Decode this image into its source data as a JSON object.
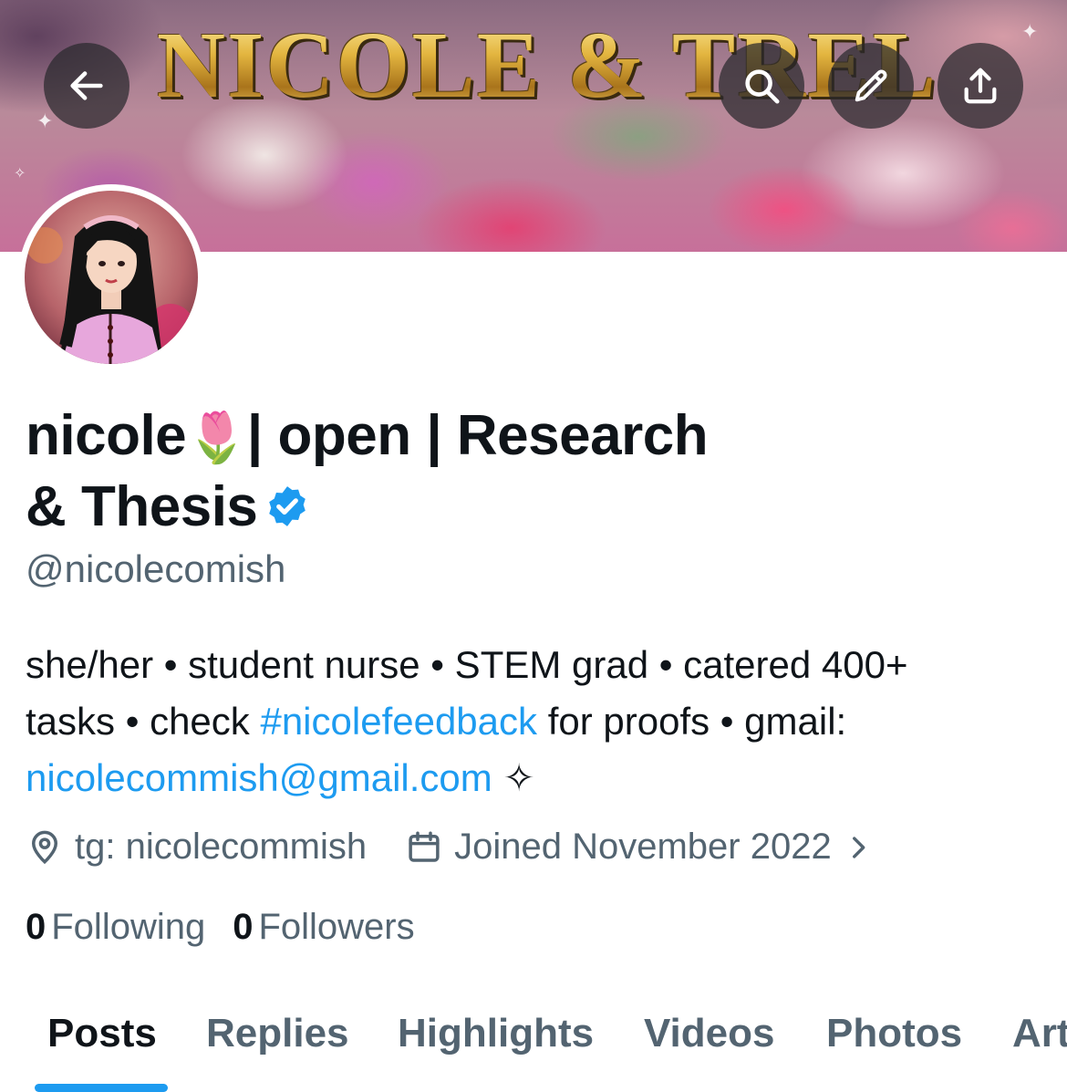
{
  "header": {
    "banner_title": "NICOLE & TREL",
    "back_label": "Back",
    "search_label": "Search",
    "edit_label": "Edit",
    "share_label": "Share",
    "icons": [
      "arrow-left-icon",
      "search-icon",
      "pencil-icon",
      "share-icon"
    ]
  },
  "profile": {
    "name_line1_part1": "nicole",
    "name_emoji": "🌷",
    "name_line1_part2": "| open | Research",
    "name_line2": "& Thesis",
    "handle": "@nicolecomish",
    "verified_color": "#1d9bf0"
  },
  "bio": {
    "line1": "she/her • student nurse • STEM grad • catered 400+",
    "line2_a": "tasks • check ",
    "hashtag": "#nicolefeedback",
    "line2_b": " for proofs • gmail:",
    "email": "nicolecommish@gmail.com",
    "sparkle": " ✧"
  },
  "meta": {
    "location": "tg: nicolecommish",
    "joined": "Joined November 2022",
    "icons": [
      "location-pin-icon",
      "calendar-icon",
      "chevron-right-icon"
    ]
  },
  "stats": {
    "following_count": "0",
    "following_label": "Following",
    "followers_count": "0",
    "followers_label": "Followers"
  },
  "tabs": [
    {
      "label": "Posts",
      "active": true
    },
    {
      "label": "Replies",
      "active": false
    },
    {
      "label": "Highlights",
      "active": false
    },
    {
      "label": "Videos",
      "active": false
    },
    {
      "label": "Photos",
      "active": false
    },
    {
      "label": "Articles",
      "active": false
    }
  ],
  "colors": {
    "accent": "#1d9bf0",
    "text": "#0f1419",
    "secondary_text": "#536471"
  }
}
